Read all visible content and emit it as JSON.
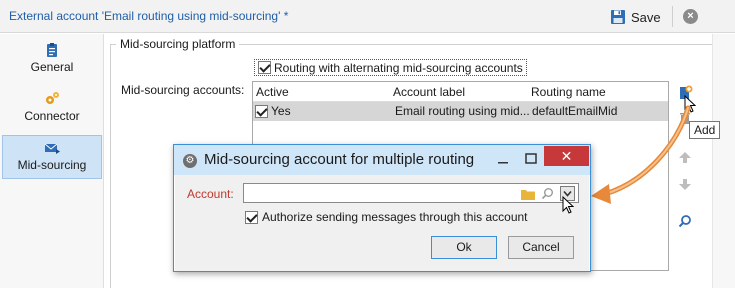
{
  "window": {
    "title": "External account 'Email routing using mid-sourcing' *",
    "save_label": "Save",
    "close_glyph": "×"
  },
  "sidebar": {
    "items": [
      {
        "label": "General",
        "icon": "clipboard-icon",
        "active": false
      },
      {
        "label": "Connector",
        "icon": "gears-icon",
        "active": false
      },
      {
        "label": "Mid-sourcing",
        "icon": "envelope-arrows-icon",
        "active": true
      }
    ]
  },
  "form": {
    "group_title": "Mid-sourcing platform",
    "routing_checkbox_label": "Routing with alternating mid-sourcing accounts",
    "routing_checked": true,
    "accounts_label": "Mid-sourcing accounts:",
    "grid": {
      "columns": [
        "Active",
        "Account label",
        "Routing name"
      ],
      "rows": [
        {
          "active_checked": true,
          "active": "Yes",
          "account_label": "Email routing using mid...",
          "routing_name": "defaultEmailMid"
        }
      ]
    },
    "tools": {
      "add_tooltip": "Add"
    }
  },
  "dialog": {
    "title": "Mid-sourcing account for multiple routing",
    "icon_glyph": "⚙",
    "close_glyph": "✕",
    "account_label": "Account:",
    "account_value": "",
    "authorize_label": "Authorize sending messages through this account",
    "authorize_checked": true,
    "ok_label": "Ok",
    "cancel_label": "Cancel"
  },
  "colors": {
    "title_link": "#1f5ea8",
    "active_nav": "#cfe3f6",
    "dialog_title_bg": "#cfe5f8",
    "close_red": "#c7383b",
    "required_label": "#c0392b",
    "annotation_arrow": "#e8883a"
  }
}
